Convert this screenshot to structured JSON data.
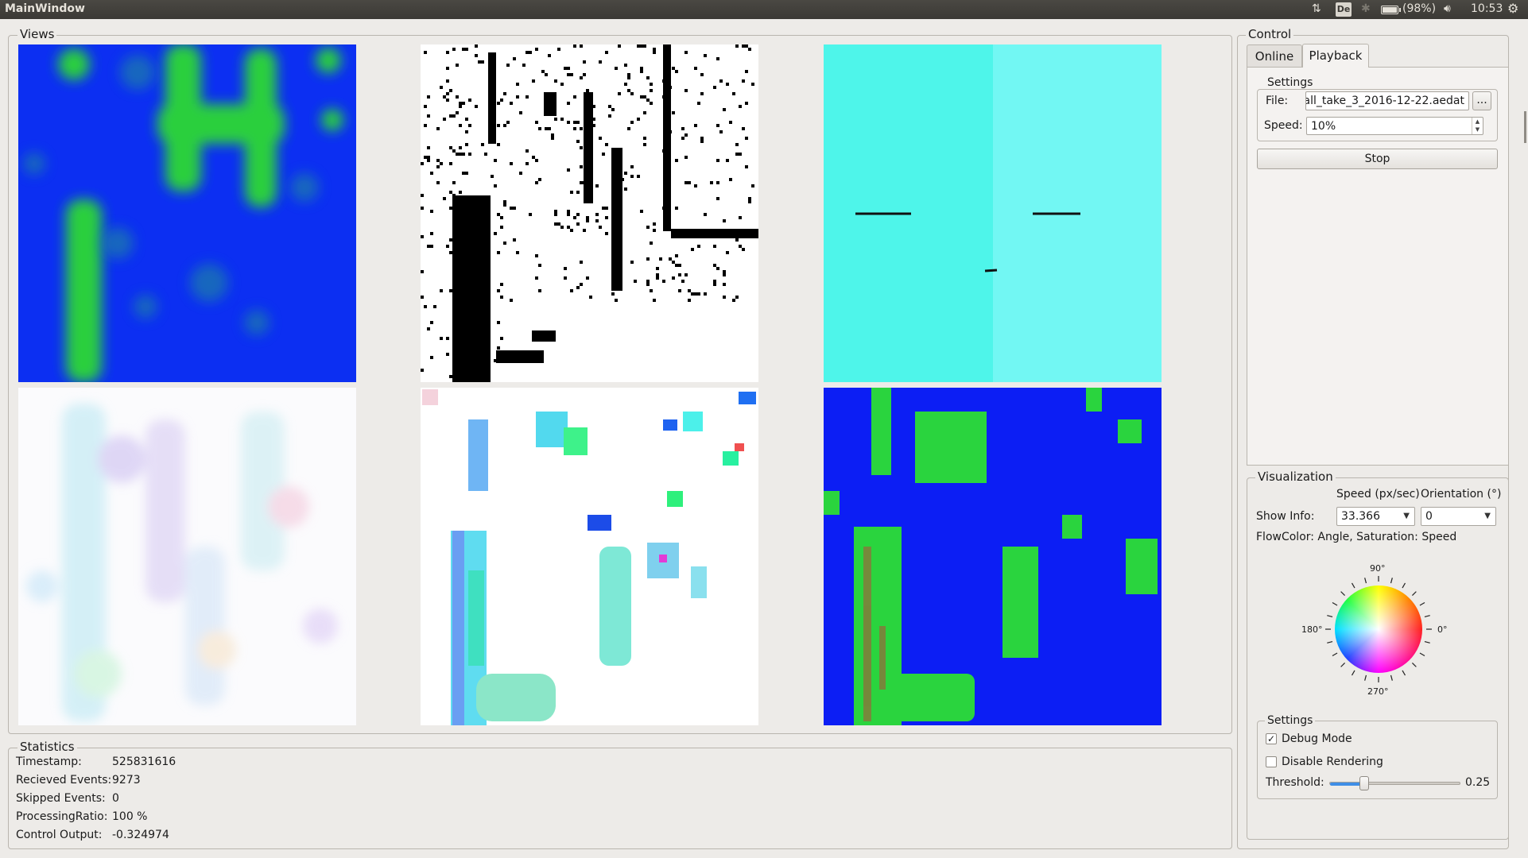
{
  "window": {
    "title": "MainWindow"
  },
  "system_tray": {
    "keyboard_layout": "De",
    "battery_text": "(98%)",
    "battery_level": 0.98,
    "clock": "10:53"
  },
  "views": {
    "title": "Views",
    "panels": [
      {
        "id": "speed-map",
        "palette": "blue-green"
      },
      {
        "id": "event-image",
        "palette": "black-white"
      },
      {
        "id": "control-map",
        "palette": "cyan"
      },
      {
        "id": "flow-field-faded",
        "palette": "pastel-rainbow"
      },
      {
        "id": "flow-field",
        "palette": "rainbow"
      },
      {
        "id": "speed-map-pixelated",
        "palette": "blue-green"
      }
    ]
  },
  "statistics": {
    "title": "Statistics",
    "rows": [
      {
        "label": "Timestamp:",
        "value": "525831616"
      },
      {
        "label": "Recieved Events:",
        "value": "9273"
      },
      {
        "label": "Skipped Events:",
        "value": "0"
      },
      {
        "label": "ProcessingRatio:",
        "value": "100 %"
      },
      {
        "label": "Control Output:",
        "value": "-0.324974"
      }
    ]
  },
  "control": {
    "title": "Control",
    "tabs": [
      {
        "label": "Online",
        "active": false
      },
      {
        "label": "Playback",
        "active": true
      }
    ],
    "settings": {
      "title": "Settings",
      "file_label": "File:",
      "file_value": "all_take_3_2016-12-22.aedat",
      "browse_label": "...",
      "speed_label": "Speed:",
      "speed_value": "10%",
      "stop_label": "Stop"
    }
  },
  "visualization": {
    "title": "Visualization",
    "speed_header": "Speed (px/sec)",
    "orientation_header": "Orientation (°)",
    "show_info_label": "Show Info:",
    "speed_value": "33.366",
    "orientation_value": "0",
    "flow_color_text": "FlowColor: Angle, Saturation: Speed",
    "wheel_labels": {
      "top": "90°",
      "left": "180°",
      "right": "0°",
      "bottom": "270°"
    }
  },
  "vis_settings": {
    "title": "Settings",
    "debug_mode_label": "Debug Mode",
    "debug_mode_checked": true,
    "check_mark": "✓",
    "disable_rendering_label": "Disable Rendering",
    "disable_rendering_checked": false,
    "threshold_label": "Threshold:",
    "threshold_value": "0.25",
    "threshold_fraction": 0.25
  }
}
